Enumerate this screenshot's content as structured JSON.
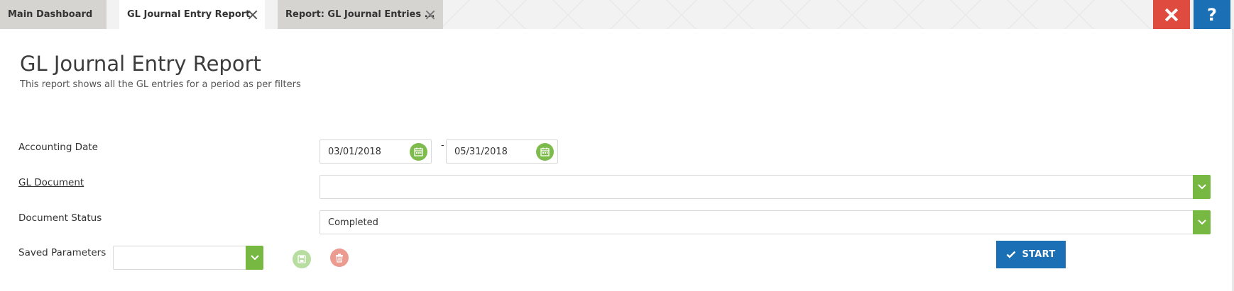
{
  "tabs": [
    {
      "label": "Main Dashboard",
      "closable": false,
      "active": false
    },
    {
      "label": "GL Journal Entry Report",
      "closable": true,
      "active": true
    },
    {
      "label": "Report: GL Journal Entries ...",
      "closable": true,
      "active": false
    }
  ],
  "window_buttons": {
    "close_icon": "close-icon",
    "help_label": "?"
  },
  "header": {
    "title": "GL Journal Entry Report",
    "subtitle": "This report shows all the GL entries for a period as per filters"
  },
  "form": {
    "accounting_date": {
      "label": "Accounting Date",
      "from": "03/01/2018",
      "separator": "-",
      "to": "05/31/2018"
    },
    "gl_document": {
      "label": "GL Document",
      "value": ""
    },
    "document_status": {
      "label": "Document Status",
      "value": "Completed"
    },
    "saved_parameters": {
      "label": "Saved Parameters",
      "value": ""
    }
  },
  "actions": {
    "start_label": "START"
  },
  "colors": {
    "accent_green": "#77b843",
    "primary_blue": "#1a6fb5",
    "danger_red": "#e04b3f"
  }
}
